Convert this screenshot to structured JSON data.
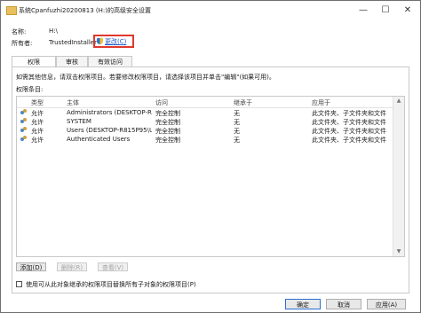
{
  "window": {
    "title": "系统Cpanfuzhi20200813 (H:)的高级安全设置",
    "minimize": "—",
    "maximize": "☐",
    "close": "✕"
  },
  "name": {
    "label": "名称:",
    "value": "H:\\"
  },
  "owner": {
    "label": "所有者:",
    "value": "TrustedInstaller",
    "change_link": "更改(C)"
  },
  "tabs": [
    {
      "label": "权限",
      "active": true
    },
    {
      "label": "审核",
      "active": false
    },
    {
      "label": "有效访问",
      "active": false
    }
  ],
  "info_text": "如需其他信息，请双击权限项目。若要修改权限项目，请选择该项目并单击\"编辑\"(如果可用)。",
  "entries_label": "权限条目:",
  "columns": [
    "类型",
    "主体",
    "访问",
    "继承于",
    "应用于"
  ],
  "entries": [
    {
      "type": "允许",
      "principal": "Administrators (DESKTOP-R815P...",
      "access": "完全控制",
      "inherited": "无",
      "applies_to": "此文件夹、子文件夹和文件"
    },
    {
      "type": "允许",
      "principal": "SYSTEM",
      "access": "完全控制",
      "inherited": "无",
      "applies_to": "此文件夹、子文件夹和文件"
    },
    {
      "type": "允许",
      "principal": "Users (DESKTOP-R815P95\\Users)",
      "access": "完全控制",
      "inherited": "无",
      "applies_to": "此文件夹、子文件夹和文件"
    },
    {
      "type": "允许",
      "principal": "Authenticated Users",
      "access": "完全控制",
      "inherited": "无",
      "applies_to": "此文件夹、子文件夹和文件"
    }
  ],
  "buttons": {
    "add": "添加(D)",
    "remove": "删除(R)",
    "view": "查看(V)"
  },
  "checkbox_label": "使用可从此对象继承的权限项目替换所有子对象的权限项目(P)",
  "footer": {
    "ok": "确定",
    "cancel": "取消",
    "apply": "应用(A)"
  },
  "colors": {
    "highlight_box": "#e0392b",
    "link": "#1a56c8"
  }
}
